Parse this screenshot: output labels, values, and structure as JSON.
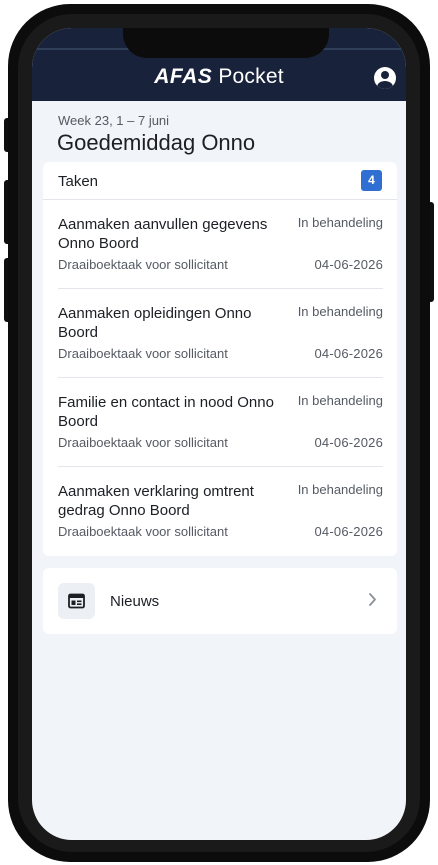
{
  "app": {
    "brand_strong": "AFAS",
    "brand_light": "Pocket"
  },
  "header": {
    "week": "Week 23, 1 – 7 juni",
    "greeting": "Goedemiddag Onno"
  },
  "tasks": {
    "title": "Taken",
    "count": "4",
    "items": [
      {
        "title": "Aanmaken aanvullen gegevens Onno Boord",
        "status": "In behandeling",
        "subtitle": "Draaiboektaak voor sollicitant",
        "date": "04-06-2026"
      },
      {
        "title": "Aanmaken opleidingen Onno Boord",
        "status": "In behandeling",
        "subtitle": "Draaiboektaak voor sollicitant",
        "date": "04-06-2026"
      },
      {
        "title": "Familie en contact in nood Onno Boord",
        "status": "In behandeling",
        "subtitle": "Draaiboektaak voor sollicitant",
        "date": "04-06-2026"
      },
      {
        "title": "Aanmaken verklaring omtrent gedrag Onno Boord",
        "status": "In behandeling",
        "subtitle": "Draaiboektaak voor sollicitant",
        "date": "04-06-2026"
      }
    ]
  },
  "news": {
    "label": "Nieuws",
    "icon": "newspaper-icon"
  },
  "colors": {
    "header_bg": "#18223a",
    "badge_bg": "#2f6fd1",
    "screen_bg": "#f1f4f8"
  }
}
